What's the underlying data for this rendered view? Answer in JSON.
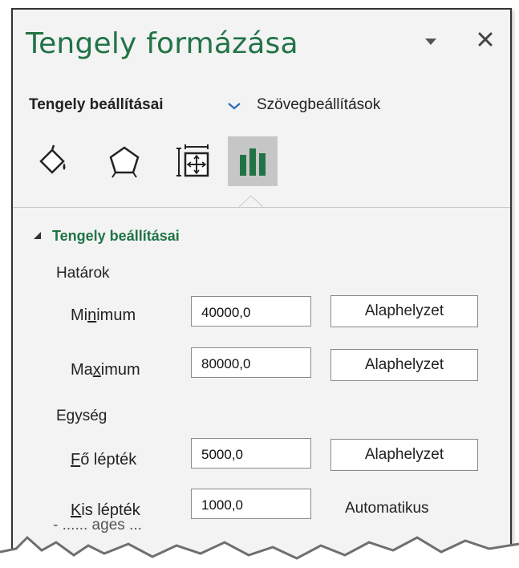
{
  "pane": {
    "title": "Tengely formázása",
    "dropdown_icon": "triangle-down-icon",
    "close_icon": "close-icon"
  },
  "tabs": {
    "active": "Tengely beállításai",
    "chevron_icon": "chevron-down-icon",
    "other": "Szövegbeállítások"
  },
  "icons": [
    {
      "name": "fill-line-icon",
      "selected": false
    },
    {
      "name": "effects-pentagon-icon",
      "selected": false
    },
    {
      "name": "size-properties-icon",
      "selected": false
    },
    {
      "name": "axis-options-bar-chart-icon",
      "selected": true
    }
  ],
  "section": {
    "title": "Tengely beállításai",
    "groups": {
      "bounds_label": "Határok",
      "units_label": "Egység"
    },
    "fields": {
      "minimum": {
        "label_pre": "Mi",
        "label_ul": "n",
        "label_post": "imum",
        "value": "40000,0",
        "button": "Alaphelyzet"
      },
      "maximum": {
        "label_pre": "Ma",
        "label_ul": "x",
        "label_post": "imum",
        "value": "80000,0",
        "button": "Alaphelyzet"
      },
      "major": {
        "label_pre": "",
        "label_ul": "F",
        "label_post": "ő lépték",
        "value": "5000,0",
        "button": "Alaphelyzet"
      },
      "minor": {
        "label_pre": "",
        "label_ul": "K",
        "label_post": "is lépték",
        "value": "1000,0",
        "status": "Automatikus"
      }
    }
  },
  "torn_edge_text": "- ...... ages ...",
  "colors": {
    "accent": "#217346",
    "pane_bg": "#f3f3f3",
    "selected_icon_bg": "#c6c6c6"
  }
}
